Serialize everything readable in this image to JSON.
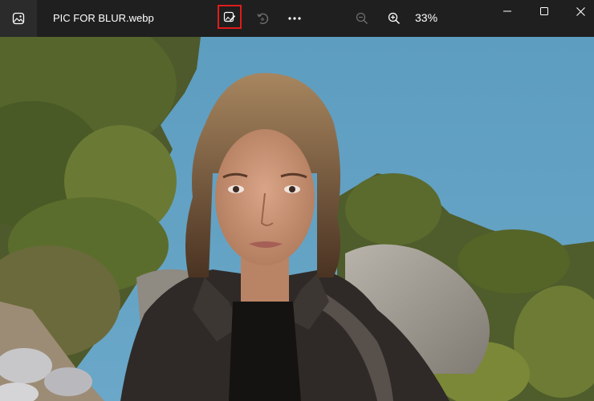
{
  "titlebar": {
    "file_name": "PIC FOR BLUR.webp",
    "zoom_level": "33%"
  },
  "icons": {
    "app": "photos-app-icon",
    "edit": "edit-image-icon",
    "rotate": "rotate-icon",
    "more": "more-options-icon",
    "zoom_out": "zoom-out-icon",
    "zoom_in": "zoom-in-icon",
    "minimize": "minimize-icon",
    "maximize": "maximize-icon",
    "close": "close-icon"
  },
  "colors": {
    "titlebar": "#1f1f1f",
    "highlight": "#e11b1b",
    "sky": "#5f9ec0"
  }
}
